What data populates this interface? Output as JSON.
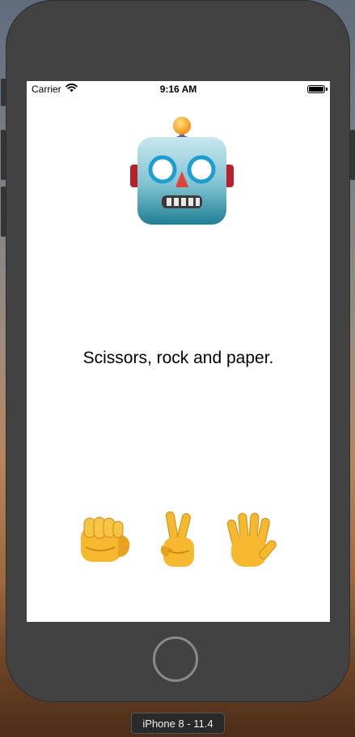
{
  "status_bar": {
    "carrier": "Carrier",
    "time": "9:16 AM",
    "battery_level": 1.0
  },
  "robot": {
    "icon": "robot-face-icon"
  },
  "message": "Scissors, rock and paper.",
  "choices": [
    {
      "name": "rock",
      "icon": "oncoming-fist-icon"
    },
    {
      "name": "scissors",
      "icon": "victory-hand-icon"
    },
    {
      "name": "paper",
      "icon": "raised-hand-icon"
    }
  ],
  "simulator": {
    "device_label": "iPhone 8 - 11.4"
  },
  "colors": {
    "device_frame": "#424242",
    "screen_bg": "#ffffff",
    "skin": "#f5b82e"
  }
}
